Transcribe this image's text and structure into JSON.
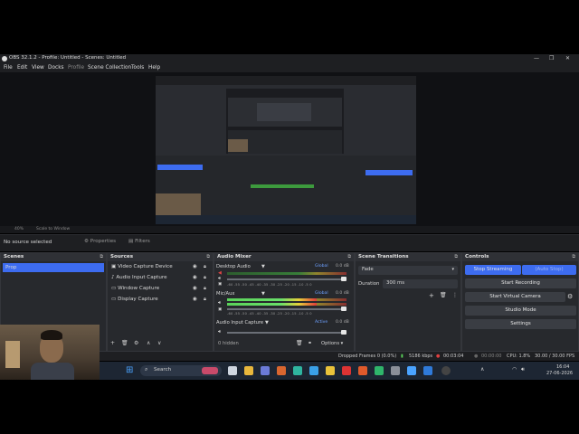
{
  "window": {
    "title": "OBS 32.1.2 - Profile: Untitled - Scenes: Untitled",
    "controls": [
      "—",
      "❐",
      "✕"
    ]
  },
  "menu": {
    "items": [
      "File",
      "Edit",
      "View",
      "Docks",
      "Profile",
      "Scene Collection",
      "Tools",
      "Help"
    ]
  },
  "preview": {
    "zoom": "40%",
    "zoom_mode": "Scale to Window"
  },
  "source_toolbar": {
    "no_source": "No source selected",
    "properties": "Properties",
    "filters": "Filters"
  },
  "scenes": {
    "title": "Scenes",
    "items": [
      "Prop"
    ]
  },
  "sources": {
    "title": "Sources",
    "items": [
      "Video Capture Device",
      "Audio Input Capture",
      "Window Capture",
      "Display Capture"
    ]
  },
  "audio_mixer": {
    "title": "Audio Mixer",
    "channels": [
      {
        "name": "Desktop Audio",
        "tag": "Global",
        "db": "0.0 dB",
        "level": 0.0
      },
      {
        "name": "Mic/Aux",
        "tag": "Global",
        "db": "0.0 dB",
        "level": 0.75
      },
      {
        "name": "Audio Input Capture",
        "tag": "Active",
        "db": "0.0 dB",
        "level": 0.0
      }
    ],
    "ticks": "-60 -55 -50 -45 -40 -35 -30 -25 -20 -15 -10 -5 0",
    "hidden": "0 hidden",
    "options": "Options"
  },
  "transitions": {
    "title": "Scene Transitions",
    "type": "Fade",
    "duration_label": "Duration",
    "duration_value": "300 ms"
  },
  "controls": {
    "title": "Controls",
    "stop_streaming": "Stop Streaming",
    "auto_stop": "(Auto Stop)",
    "start_recording": "Start Recording",
    "start_virtual_camera": "Start Virtual Camera",
    "studio_mode": "Studio Mode",
    "settings": "Settings"
  },
  "status": {
    "dropped_frames": "Dropped Frames 0 (0.0%)",
    "bitrate": "5186 kbps",
    "stream_time": "00:03:04",
    "rec_time": "00:00:00",
    "cpu": "CPU: 1.8%",
    "fps": "30.00 / 30.00 FPS"
  },
  "taskbar": {
    "search": "Search",
    "time": "16:04",
    "date": "27-06-2026"
  },
  "colors": {
    "accent": "#3d6cf0",
    "panel": "#27292d",
    "taskbar": "#1d2633"
  }
}
